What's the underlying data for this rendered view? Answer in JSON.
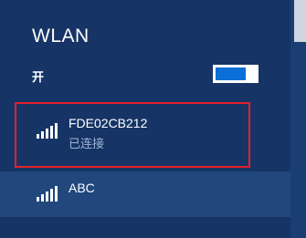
{
  "panel": {
    "title": "WLAN",
    "toggle": {
      "label": "开",
      "state": "on",
      "accent_color": "#0a6fd6"
    }
  },
  "networks": [
    {
      "ssid": "FDE02CB212",
      "status": "已连接",
      "signal_icon": "wifi-signal-icon",
      "signal_bars": 5,
      "highlighted": true
    },
    {
      "ssid": "ABC",
      "signal_icon": "wifi-signal-icon",
      "signal_bars": 5,
      "highlighted": false
    }
  ],
  "colors": {
    "background": "#163566",
    "selected_row": "#21477d",
    "highlight_border": "#e3202a"
  }
}
